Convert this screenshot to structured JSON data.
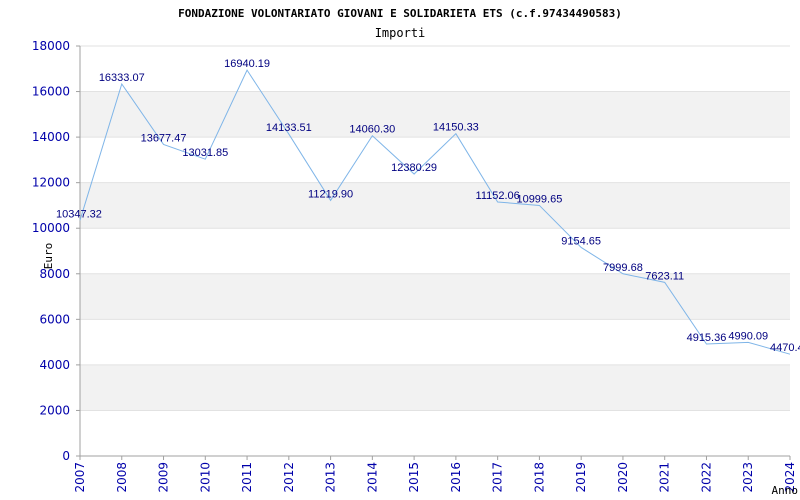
{
  "chart_data": {
    "type": "line",
    "title": "FONDAZIONE VOLONTARIATO GIOVANI E SOLIDARIETA ETS (c.f.97434490583)",
    "subtitle": "Importi",
    "xlabel": "Anno",
    "ylabel": "Euro",
    "ylim": [
      0,
      18000
    ],
    "y_ticks": [
      "0",
      "2000",
      "4000",
      "6000",
      "8000",
      "10000",
      "12000",
      "14000",
      "16000",
      "18000"
    ],
    "x": [
      "2007",
      "2008",
      "2009",
      "2010",
      "2011",
      "2012",
      "2013",
      "2014",
      "2015",
      "2016",
      "2017",
      "2018",
      "2019",
      "2020",
      "2021",
      "2022",
      "2023",
      "2024"
    ],
    "values": [
      10347.32,
      16333.07,
      13677.47,
      13031.85,
      16940.19,
      14133.51,
      11219.9,
      14060.3,
      12380.29,
      14150.33,
      11152.06,
      10999.65,
      9154.65,
      7999.68,
      7623.11,
      4915.36,
      4990.09,
      4470.4
    ],
    "value_labels": [
      "10347.32",
      "16333.07",
      "13677.47",
      "13031.85",
      "16940.19",
      "14133.51",
      "11219.90",
      "14060.30",
      "12380.29",
      "14150.33",
      "11152.06",
      "10999.65",
      "9154.65",
      "7999.68",
      "7623.11",
      "4915.36",
      "4990.09",
      "4470.4"
    ],
    "grid": true,
    "colors": {
      "line": "#7fb5e8",
      "band": "#f2f2f2",
      "axis": "#a0a0a0",
      "tick_text": "#0000aa",
      "label_text": "#000080"
    }
  }
}
